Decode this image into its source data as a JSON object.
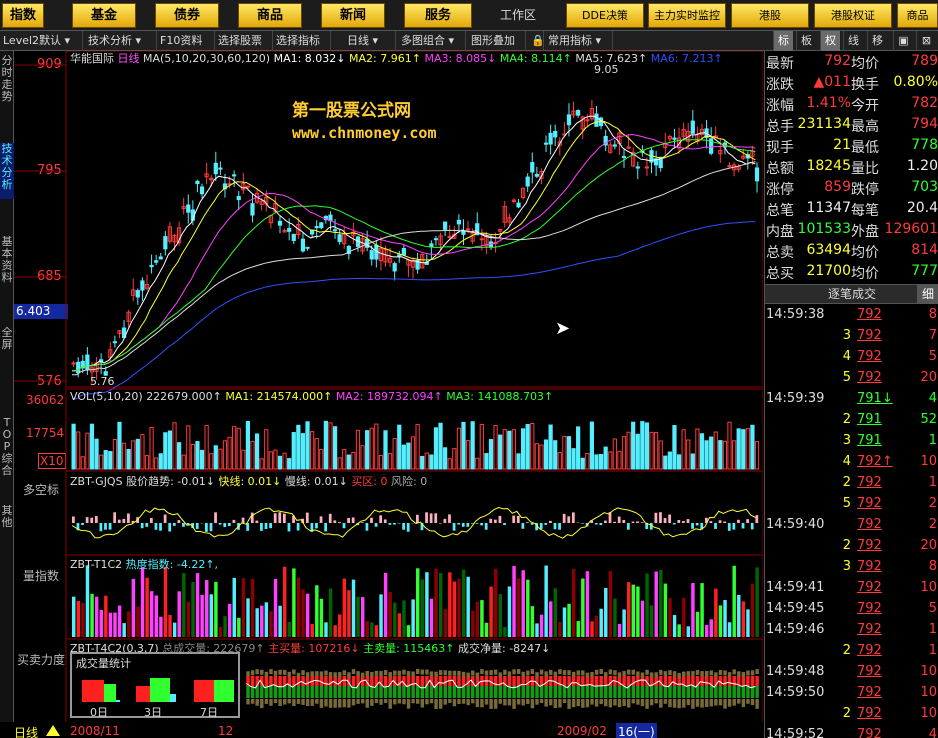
{
  "top_nav": [
    "指数",
    "基金",
    "债券",
    "商品",
    "新闻",
    "服务"
  ],
  "top_right": {
    "workspace": "工作区",
    "dde": "DDE决策",
    "monitor": "主力实时监控",
    "hk": "港股",
    "hk_warrant": "港股权证",
    "commodity": "商品"
  },
  "toolbar": [
    "Level2默认",
    "技术分析",
    "F10资料",
    "选择股票",
    "选择指标",
    "日线",
    "多图组合",
    "图形叠加",
    "常用指标"
  ],
  "right_tabs": [
    "标",
    "板",
    "权",
    "线",
    "移"
  ],
  "sidebar": [
    "分时走势",
    "技术分析",
    "基本资料",
    "全屏",
    "TOP综合",
    "其他"
  ],
  "panel_titles": {
    "p3": "多空标",
    "p4": "量指数",
    "p5": "买卖力度"
  },
  "main": {
    "name": "华能国际",
    "period": "日线",
    "ma_header": "MA(5,10,20,30,60,120)",
    "ma1": "MA1: 8.032↓",
    "ma2": "MA2: 7.961↑",
    "ma3": "MA3: 8.085↓",
    "ma4": "MA4: 8.114↑",
    "ma5": "MA5: 7.623↑",
    "ma6": "MA6: 7.213↑",
    "high_label": "9.05",
    "low_label": "5.76",
    "watermark1": "第一股票公式网",
    "watermark2": "www.chnmoney.com"
  },
  "price_axis": [
    "909",
    "795",
    "685",
    "576"
  ],
  "cursor_price": "6.403",
  "vol": {
    "header": "VOL(5,10,20)",
    "v": "222679.000↑",
    "ma1": "MA1: 214574.000↑",
    "ma2": "MA2: 189732.094↑",
    "ma3": "MA3: 141088.703↑",
    "axis": [
      "36062",
      "17754",
      "X10"
    ]
  },
  "gjqs": {
    "header": "ZBT-GJQS",
    "trend": "股价趋势: -0.01↓",
    "fast": "快线: 0.01↓",
    "slow": "慢线: 0.01↓",
    "buy": "买区: 0",
    "risk": "风险: 0"
  },
  "t1c2": {
    "header": "ZBT-T1C2",
    "heat": "热度指数: -4.22↑,"
  },
  "t4c2": {
    "header": "ZBT-T4C2(0,3,7)",
    "total": "总成交量: 222679↑",
    "main_buy": "主买量: 107216↓",
    "main_sell": "主卖量: 115463↑",
    "net": "成交净量: -8247↓"
  },
  "stat": {
    "title": "成交量统计",
    "labels": [
      "0日",
      "3日",
      "7日"
    ]
  },
  "bottom": {
    "period": "日线",
    "date1": "2008/11",
    "date2": "12",
    "date3": "2009/02",
    "date4": "16(一)"
  },
  "quote": [
    {
      "l1": "最新",
      "v1": "792",
      "l2": "均价",
      "v2": "789",
      "c1": "red",
      "c2": "red"
    },
    {
      "l1": "涨跌",
      "v1": "▲011",
      "l2": "换手",
      "v2": "0.80%",
      "c1": "red",
      "c2": "yel"
    },
    {
      "l1": "涨幅",
      "v1": "1.41%",
      "l2": "今开",
      "v2": "782",
      "c1": "red",
      "c2": "red"
    },
    {
      "l1": "总手",
      "v1": "231134",
      "l2": "最高",
      "v2": "794",
      "c1": "yel",
      "c2": "red"
    },
    {
      "l1": "现手",
      "v1": "21",
      "l2": "最低",
      "v2": "778",
      "c1": "yel",
      "c2": "grn"
    },
    {
      "l1": "总额",
      "v1": "18245",
      "l2": "量比",
      "v2": "1.20",
      "c1": "yel",
      "c2": "wht"
    },
    {
      "l1": "涨停",
      "v1": "859",
      "l2": "跌停",
      "v2": "703",
      "c1": "red",
      "c2": "grn"
    },
    {
      "l1": "总笔",
      "v1": "11347",
      "l2": "每笔",
      "v2": "20.4",
      "c1": "wht",
      "c2": "wht"
    },
    {
      "l1": "内盘",
      "v1": "101533",
      "l2": "外盘",
      "v2": "129601",
      "c1": "grn",
      "c2": "red"
    },
    {
      "l1": "总卖",
      "v1": "63494",
      "l2": "均价",
      "v2": "814",
      "c1": "yel",
      "c2": "red"
    },
    {
      "l1": "总买",
      "v1": "21700",
      "l2": "均价",
      "v2": "777",
      "c1": "yel",
      "c2": "grn"
    }
  ],
  "ticks_header": "逐笔成交",
  "ticks_tab": "细",
  "ticks": [
    {
      "t": "14:59:38",
      "p": "792",
      "v": "8",
      "c": "red"
    },
    {
      "t": "",
      "p": "792",
      "v": "7",
      "c": "red"
    },
    {
      "t": "",
      "p": "792",
      "v": "5",
      "c": "red"
    },
    {
      "t": "",
      "p": "792",
      "v": "20",
      "c": "red"
    },
    {
      "t": "14:59:39",
      "p": "791↓",
      "v": "4",
      "c": "grn"
    },
    {
      "t": "",
      "p": "791",
      "v": "52",
      "c": "grn"
    },
    {
      "t": "",
      "p": "791",
      "v": "1",
      "c": "grn"
    },
    {
      "t": "",
      "p": "792↑",
      "v": "10",
      "c": "red"
    },
    {
      "t": "",
      "p": "792",
      "v": "1",
      "c": "red"
    },
    {
      "t": "",
      "p": "792",
      "v": "2",
      "c": "red"
    },
    {
      "t": "14:59:40",
      "p": "792",
      "v": "2",
      "c": "red"
    },
    {
      "t": "",
      "p": "792",
      "v": "20",
      "c": "red"
    },
    {
      "t": "",
      "p": "792",
      "v": "8",
      "c": "red"
    },
    {
      "t": "14:59:41",
      "p": "792",
      "v": "10",
      "c": "red"
    },
    {
      "t": "14:59:45",
      "p": "792",
      "v": "5",
      "c": "red"
    },
    {
      "t": "14:59:46",
      "p": "792",
      "v": "1",
      "c": "red"
    },
    {
      "t": "",
      "p": "792",
      "v": "1",
      "c": "red"
    },
    {
      "t": "14:59:48",
      "p": "792",
      "v": "10",
      "c": "red"
    },
    {
      "t": "14:59:50",
      "p": "792",
      "v": "10",
      "c": "red"
    },
    {
      "t": "",
      "p": "792",
      "v": "10",
      "c": "red"
    },
    {
      "t": "14:59:52",
      "p": "792",
      "v": "4",
      "c": "red"
    }
  ],
  "ticks_left_values": [
    "",
    "3",
    "4",
    "5",
    "",
    "2",
    "3",
    "4",
    "2",
    "5",
    "",
    "2",
    "3",
    "",
    "",
    "",
    "2",
    "",
    "",
    "2",
    ""
  ]
}
